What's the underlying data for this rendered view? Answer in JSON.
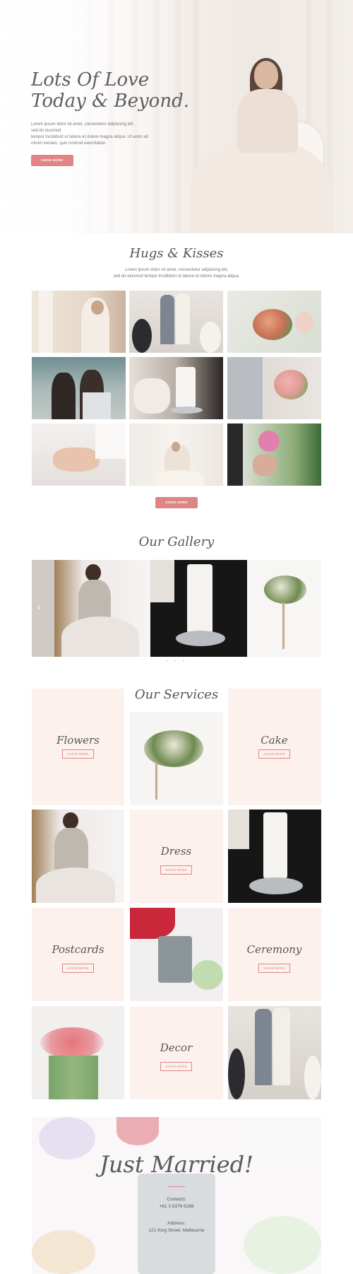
{
  "hero": {
    "title_line1": "Lots Of Love",
    "title_line2": "Today & Beyond.",
    "text_line1": "Lorem ipsum dolor sit amet, consectetur adipiscing elit,",
    "text_line2": "sed do eiusmod",
    "text_line3": "tempor incididunt ut labore et dolore magna aliqua. Ut enim ad",
    "text_line4": "minim veniam, quis nostrud exercitation.",
    "button": "Show More"
  },
  "hugs": {
    "title": "Hugs & Kisses",
    "text_line1": "Lorem ipsum dolor sit amet, consectetur adipiscing elit,",
    "text_line2": "sed do eiusmod tempor incididunt ut labore et dolore magna aliqua.",
    "button": "Show More"
  },
  "gallery": {
    "title": "Our Gallery",
    "dots": "• • •"
  },
  "services": {
    "title": "Our Services",
    "items": [
      {
        "name": "Flowers",
        "button": "Show More"
      },
      {
        "name": "Cake",
        "button": "Show More"
      },
      {
        "name": "Dress",
        "button": "Show More"
      },
      {
        "name": "Postcards",
        "button": "Show More"
      },
      {
        "name": "Ceremony",
        "button": "Show More"
      },
      {
        "name": "Decor",
        "button": "Show More"
      }
    ]
  },
  "just_married": {
    "title": "Just Married!",
    "contacts_label": "Contacts:",
    "phone": "+61 3 8376 6288",
    "address_label": "Address:",
    "address": "121 King Street, Melbourne"
  },
  "colors": {
    "accent": "#e08585",
    "tile_pink": "#fdf1ed",
    "text": "#555555"
  }
}
